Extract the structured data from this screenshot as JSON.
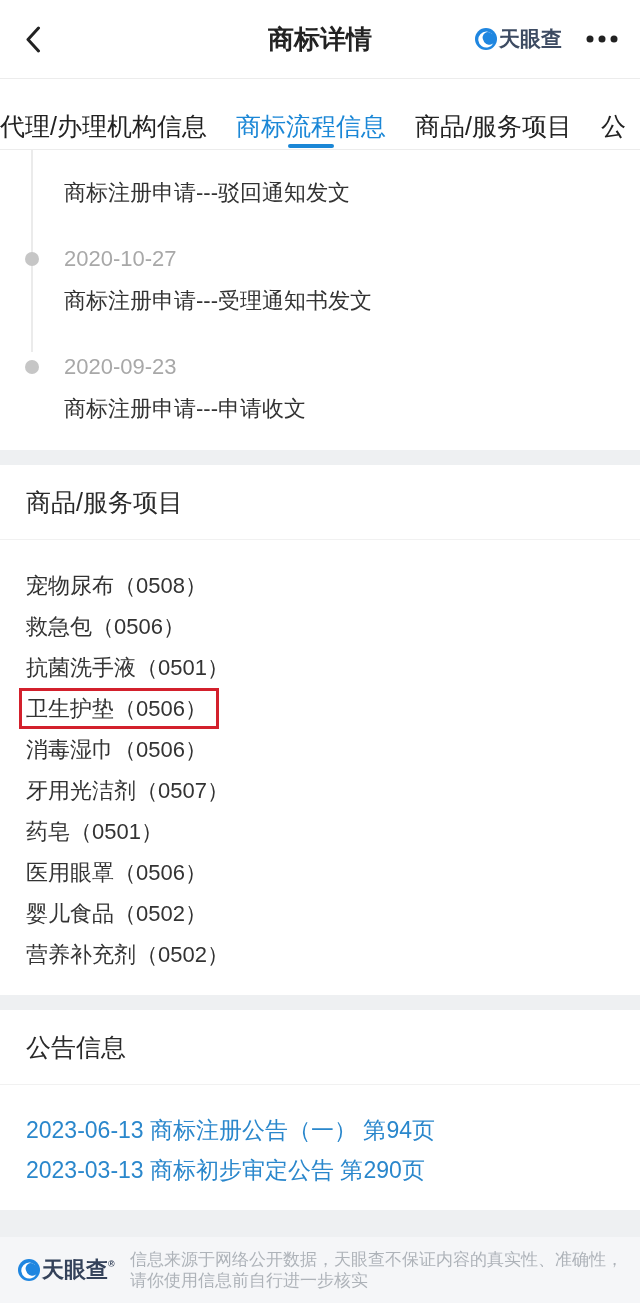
{
  "header": {
    "title": "商标详情",
    "logo": "天眼查"
  },
  "tabs": [
    {
      "label": "代理/办理机构信息",
      "selected": false
    },
    {
      "label": "商标流程信息",
      "selected": true
    },
    {
      "label": "商品/服务项目",
      "selected": false
    },
    {
      "label": "公",
      "selected": false
    }
  ],
  "timeline": [
    {
      "text": "商标注册申请---驳回通知发文"
    },
    {
      "date": "2020-10-27",
      "text": "商标注册申请---受理通知书发文"
    },
    {
      "date": "2020-09-23",
      "text": "商标注册申请---申请收文"
    }
  ],
  "goods": {
    "title": "商品/服务项目",
    "items": [
      {
        "text": "宠物尿布（0508）",
        "highlighted": false
      },
      {
        "text": "救急包（0506）",
        "highlighted": false
      },
      {
        "text": "抗菌洗手液（0501）",
        "highlighted": false
      },
      {
        "text": "卫生护垫（0506）",
        "highlighted": true
      },
      {
        "text": "消毒湿巾（0506）",
        "highlighted": false
      },
      {
        "text": "牙用光洁剂（0507）",
        "highlighted": false
      },
      {
        "text": "药皂（0501）",
        "highlighted": false
      },
      {
        "text": "医用眼罩（0506）",
        "highlighted": false
      },
      {
        "text": "婴儿食品（0502）",
        "highlighted": false
      },
      {
        "text": "营养补充剂（0502）",
        "highlighted": false
      }
    ]
  },
  "announcements": {
    "title": "公告信息",
    "links": [
      "2023-06-13 商标注册公告（一） 第94页",
      "2023-03-13 商标初步审定公告 第290页"
    ]
  },
  "footer": {
    "logo": "天眼查$^{®}$",
    "notice": "信息来源于网络公开数据，天眼查不保证内容的真实性、准确性，请你使用信息前自行进一步核实"
  }
}
